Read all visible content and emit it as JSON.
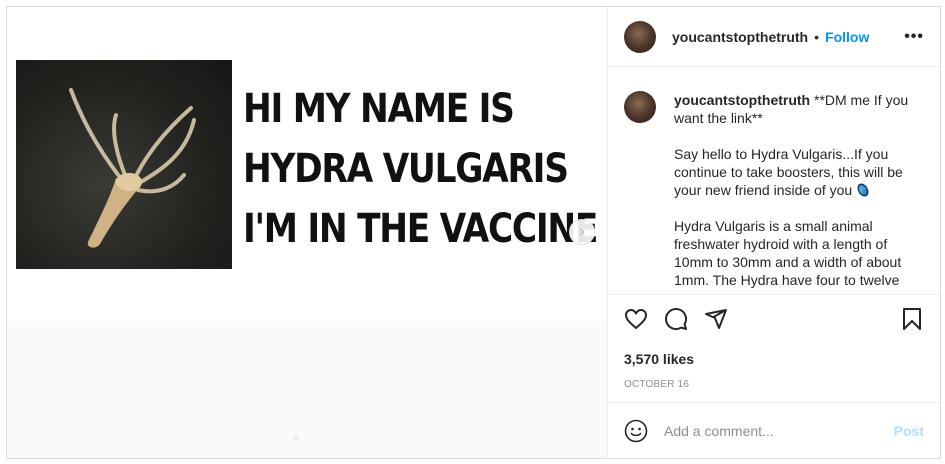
{
  "post": {
    "meme_lines": [
      "HI MY NAME IS",
      "HYDRA VULGARIS",
      "I'M IN THE VACCINE"
    ],
    "next_arrow": "›"
  },
  "header": {
    "username": "youcantstopthetruth",
    "separator": "•",
    "follow_label": "Follow",
    "more_label": "•••"
  },
  "caption": {
    "username": "youcantstopthetruth",
    "paragraph1": "**DM me If you want the link**",
    "paragraph2": "Say hello to Hydra Vulgaris...If you continue to take boosters, this will be your new friend inside of you ",
    "paragraph3": "Hydra Vulgaris is a small animal freshwater hydroid with a length of 10mm to 30mm and a width of about 1mm. The Hydra have four to twelve",
    "emoji": "pill-emoji"
  },
  "actions": {
    "icons": [
      "heart-icon",
      "comment-icon",
      "share-icon",
      "bookmark-icon"
    ]
  },
  "likes": "3,570 likes",
  "date": "OCTOBER 16",
  "add_comment": {
    "placeholder": "Add a comment...",
    "post_label": "Post"
  },
  "colors": {
    "accent": "#0095f6",
    "post_disabled": "#b2dffc",
    "muted": "#8e8e8e",
    "border": "#dbdbdb"
  }
}
